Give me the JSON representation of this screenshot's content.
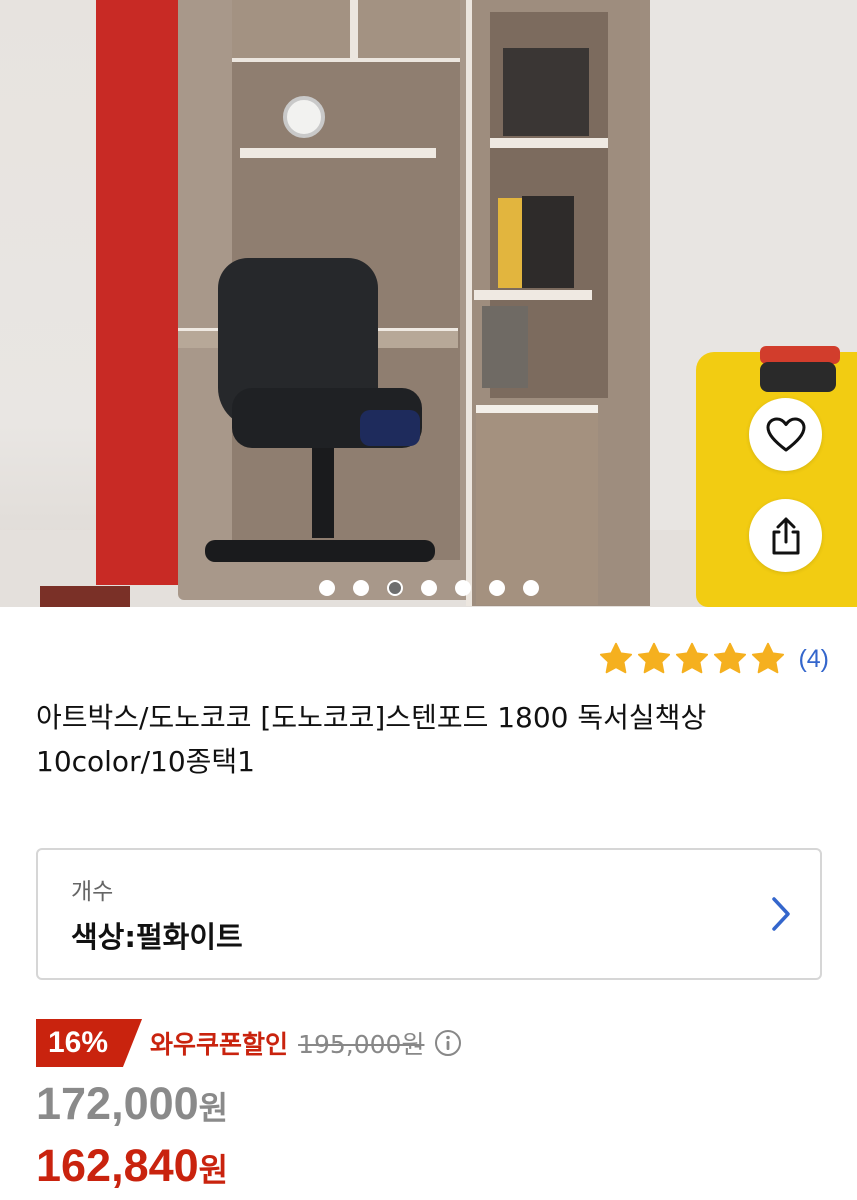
{
  "gallery": {
    "total_images": 7,
    "active_index": 2
  },
  "rating": {
    "stars": 5,
    "review_count": "(4)",
    "star_color": "#f5b01f"
  },
  "product": {
    "title": "아트박스/도노코코 [도노코코]스텐포드 1800 독서실책상 10color/10종택1"
  },
  "option": {
    "label": "개수",
    "value": "색상:펄화이트"
  },
  "price": {
    "discount_badge": "16%",
    "coupon_label": "와우쿠폰할인",
    "original_price": "195,000원",
    "list_price_number": "172,000",
    "list_price_unit": "원",
    "final_price_number": "162,840",
    "final_price_unit": "원",
    "accent_color": "#c9230e"
  },
  "icons": {
    "wishlist": "heart-icon",
    "share": "share-icon",
    "option": "chevron-right-icon",
    "info": "info-icon"
  }
}
